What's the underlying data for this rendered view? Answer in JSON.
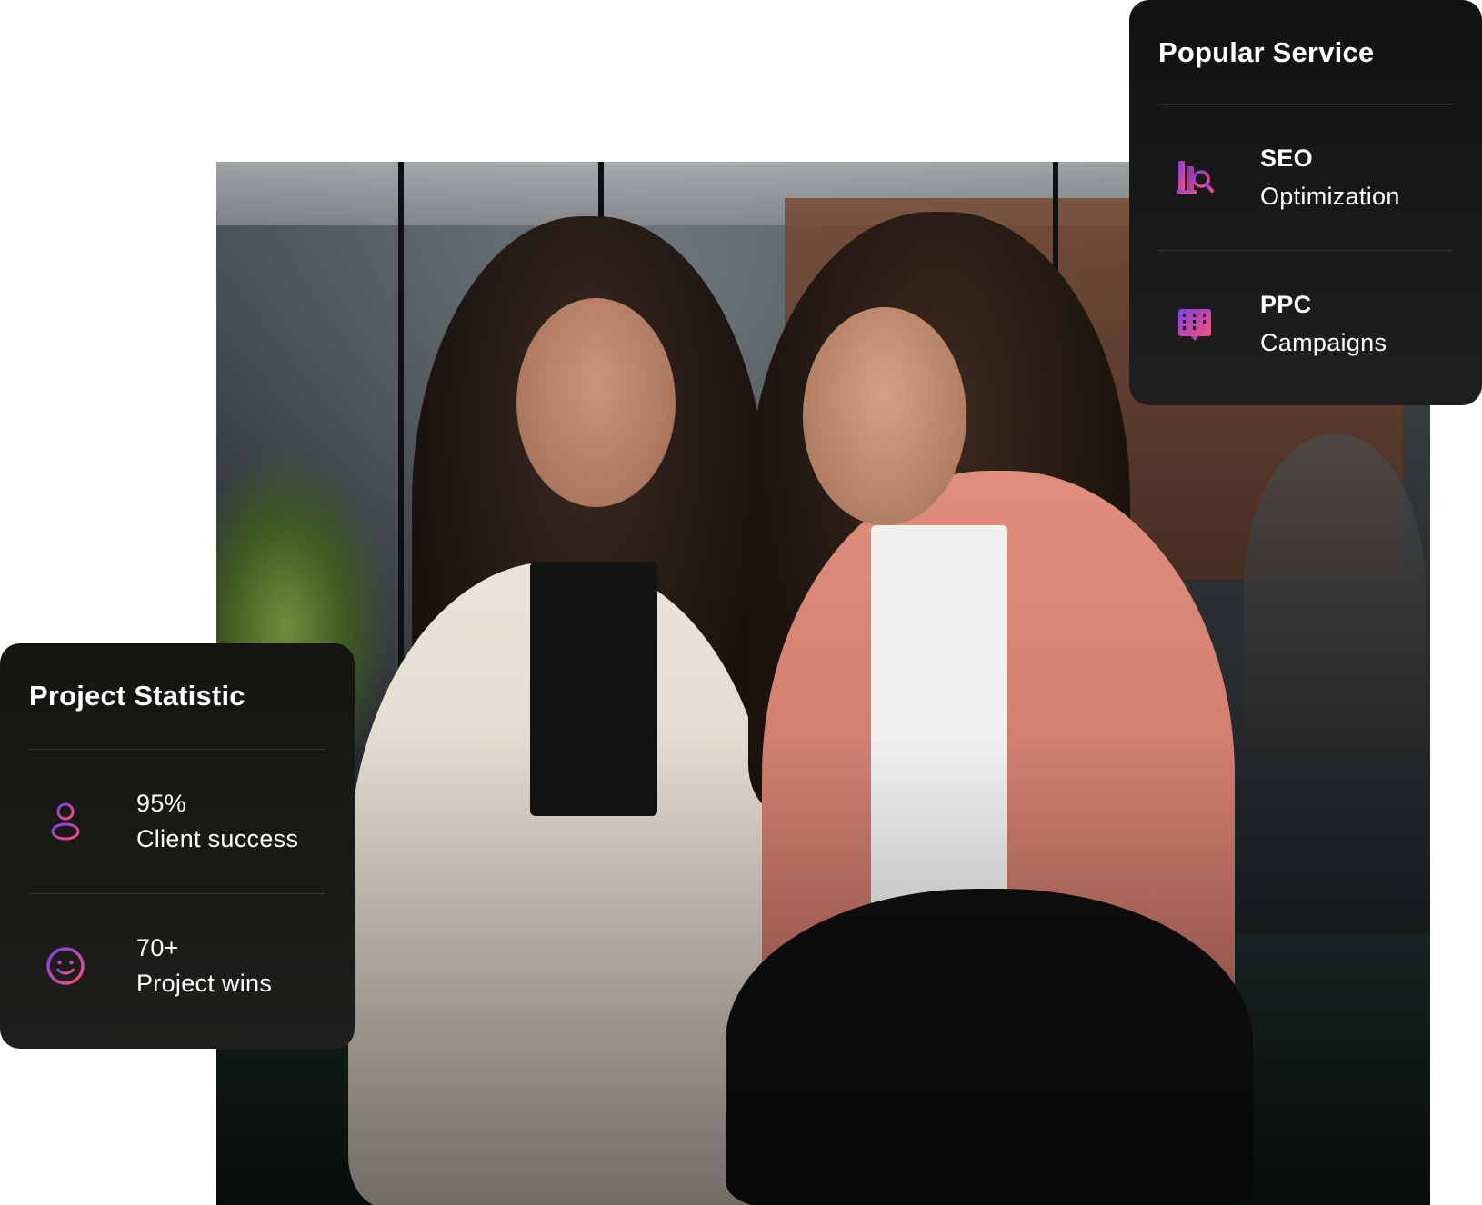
{
  "popular_service": {
    "title": "Popular Service",
    "items": [
      {
        "name": "SEO",
        "detail": "Optimization",
        "icon": "seo-search-icon"
      },
      {
        "name": "PPC",
        "detail": "Campaigns",
        "icon": "ppc-building-icon"
      }
    ]
  },
  "project_statistic": {
    "title": "Project Statistic",
    "items": [
      {
        "value": "95%",
        "label": "Client success",
        "icon": "user-icon"
      },
      {
        "value": "70+",
        "label": "Project wins",
        "icon": "smile-icon"
      }
    ]
  },
  "colors": {
    "card_bg": "#141414",
    "text": "#ffffff",
    "icon_gradient_start": "#7b3fe4",
    "icon_gradient_end": "#ff4f7a"
  }
}
